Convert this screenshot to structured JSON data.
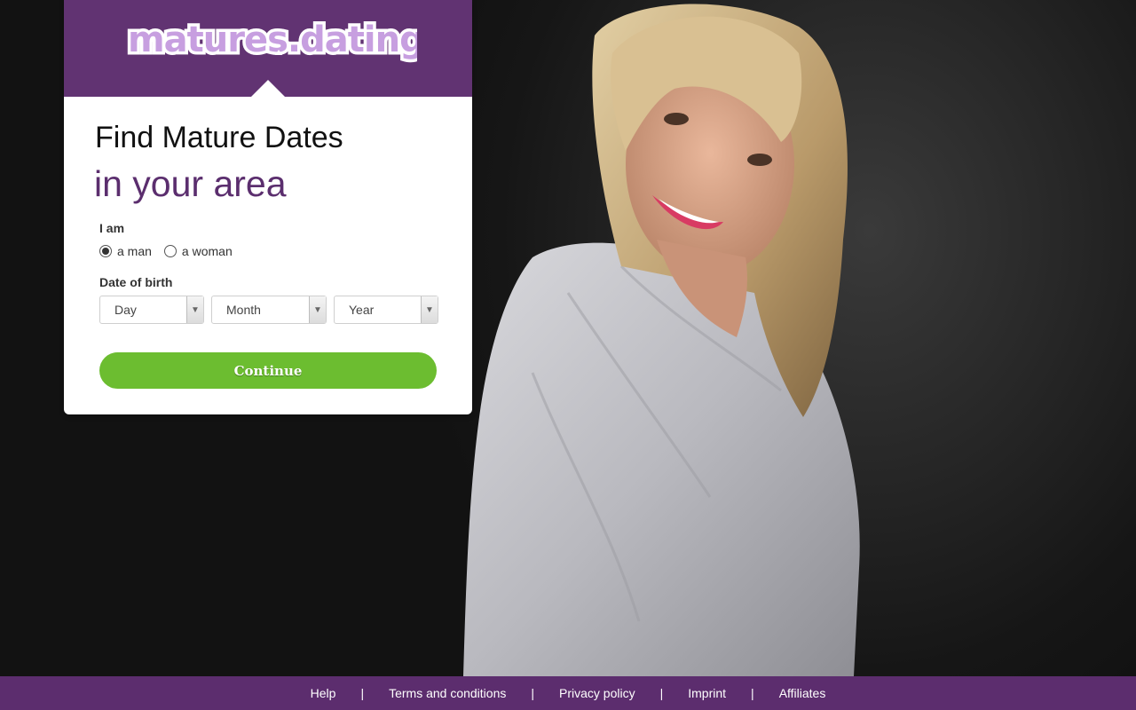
{
  "brand": {
    "logo_text": "matures.dating",
    "color": "#613372"
  },
  "form": {
    "title_line1": "Find Mature Dates",
    "title_line2": "in your area",
    "gender_label": "I am",
    "gender_options": [
      "a man",
      "a woman"
    ],
    "gender_selected": "a man",
    "dob_label": "Date of birth",
    "dob_day_placeholder": "Day",
    "dob_month_placeholder": "Month",
    "dob_year_placeholder": "Year",
    "continue_label": "Continue",
    "continue_color": "#6cbd30"
  },
  "footer": {
    "links": [
      "Help",
      "Terms and conditions",
      "Privacy policy",
      "Imprint",
      "Affiliates"
    ],
    "separator": "|"
  }
}
